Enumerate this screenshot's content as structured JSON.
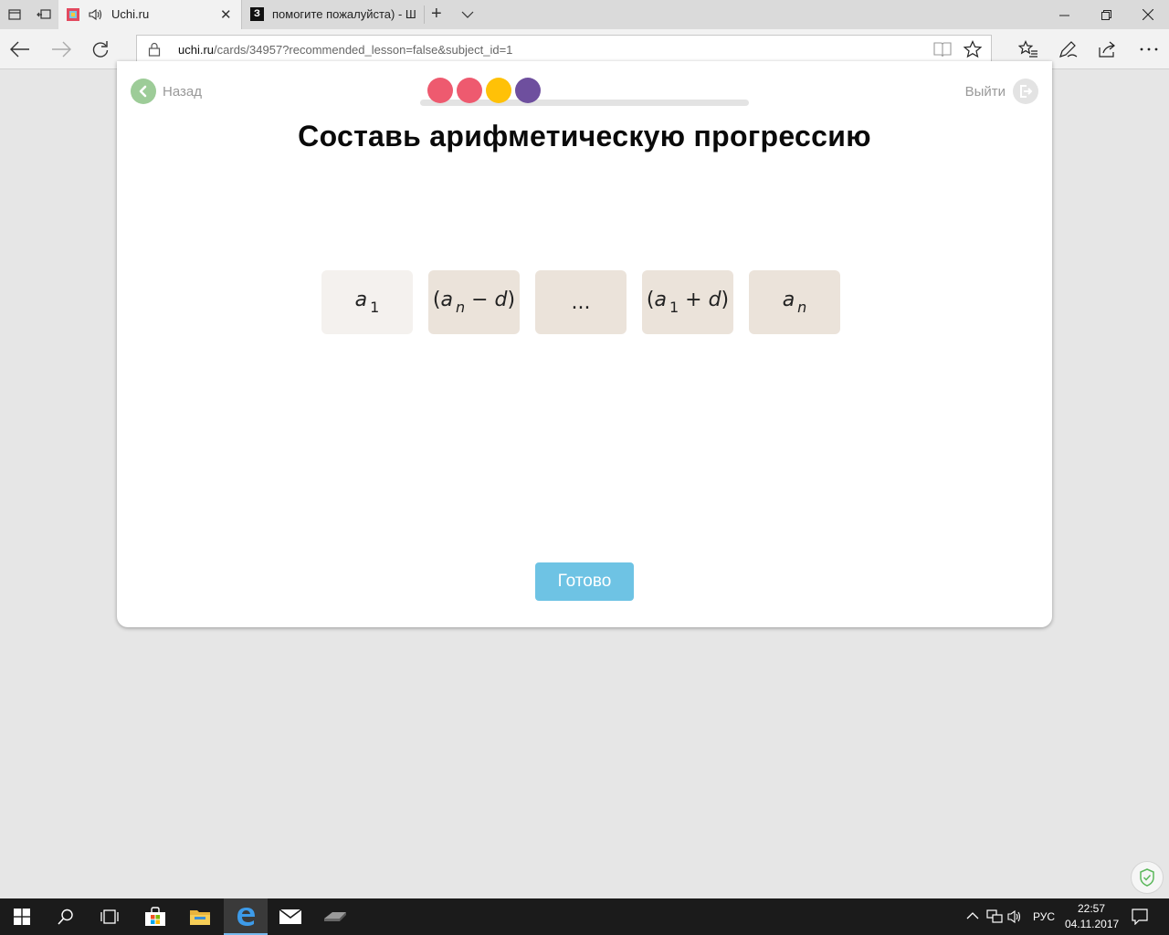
{
  "browser": {
    "tabs": [
      {
        "title": "Uchi.ru"
      },
      {
        "title": "помогите пожалуйста) - Ш"
      }
    ],
    "address": {
      "host": "uchi.ru",
      "path": "/cards/34957?recommended_lesson=false&subject_id=1"
    }
  },
  "lesson": {
    "back_label": "Назад",
    "exit_label": "Выйти",
    "title": "Составь арифметическую прогрессию",
    "progress_dots": [
      {
        "color": "#ee5a6f"
      },
      {
        "color": "#ee5a6f"
      },
      {
        "color": "#ffc107"
      },
      {
        "color": "#6e4f9e"
      }
    ],
    "tiles": [
      {
        "label": "a₁"
      },
      {
        "label": "(aₙ − d)"
      },
      {
        "label": "..."
      },
      {
        "label": "(a₁ + d)"
      },
      {
        "label": "aₙ"
      }
    ],
    "done_label": "Готово"
  },
  "taskbar": {
    "language": "РУС",
    "time": "22:57",
    "date": "04.11.2017"
  },
  "colors": {
    "back_green": "#9dcc98",
    "done_blue": "#6ec3e4",
    "tile_bg": "#ebe3da"
  }
}
